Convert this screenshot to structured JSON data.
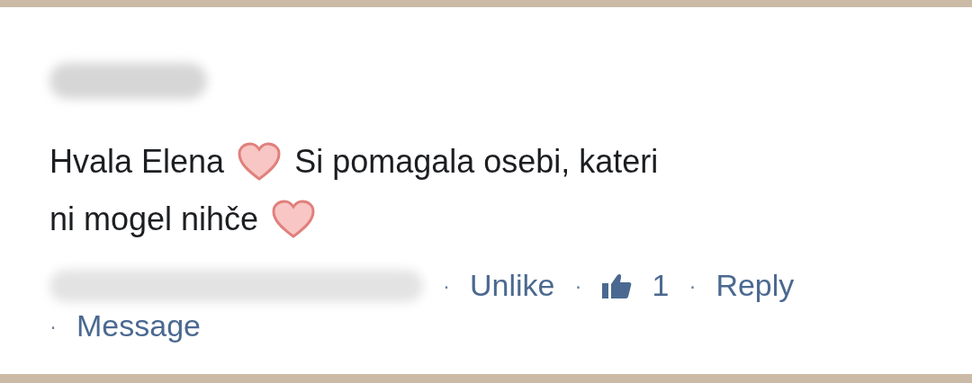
{
  "comment": {
    "author_redacted": true,
    "lines": [
      [
        {
          "kind": "text",
          "text": "Hvala Elena"
        },
        {
          "kind": "heart"
        },
        {
          "kind": "text",
          "text": "Si pomagala osebi, kateri"
        }
      ],
      [
        {
          "kind": "text",
          "text": "ni mogel nihče"
        },
        {
          "kind": "heart"
        }
      ]
    ],
    "meta_redacted": true,
    "actions": [
      {
        "kind": "link",
        "separator": "·",
        "text": "Unlike"
      },
      {
        "kind": "likes",
        "separator": "·",
        "text": "1"
      },
      {
        "kind": "link",
        "separator": "·",
        "text": "Reply"
      },
      {
        "kind": "link",
        "separator": "·",
        "text": "Message"
      }
    ]
  }
}
